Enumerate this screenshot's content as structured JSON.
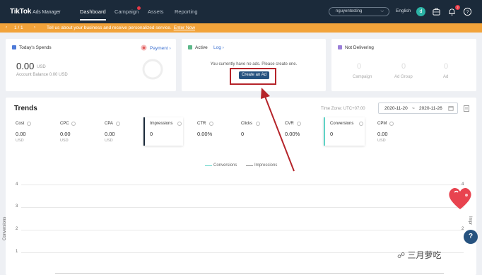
{
  "nav": {
    "logo": "TikTok",
    "logo_sub": "Ads Manager",
    "items": [
      "Dashboard",
      "Campaign",
      "Assets",
      "Reporting"
    ],
    "account": "nguyentesting",
    "language": "English",
    "avatar_letter": "d",
    "notification_count": "2"
  },
  "banner": {
    "page_indicator": "1 / 1",
    "message": "Tell us about your business and receive personalized service.",
    "link": "Enter Now"
  },
  "spends_card": {
    "title": "Today's Spends",
    "payment_label": "Payment",
    "amount": "0.00",
    "currency": "USD",
    "balance": "Account Balance 0.00 USD"
  },
  "active_card": {
    "status": "Active",
    "log_label": "Log",
    "message": "You currently have no ads. Please create one.",
    "create_button": "Create an Ad"
  },
  "not_delivering_card": {
    "title": "Not Delivering",
    "stats": [
      {
        "value": "0",
        "label": "Campaign"
      },
      {
        "value": "0",
        "label": "Ad Group"
      },
      {
        "value": "0",
        "label": "Ad"
      }
    ]
  },
  "trends": {
    "title": "Trends",
    "timezone": "Time Zone: UTC+07:00",
    "date_start": "2020-11-20",
    "date_sep": "~",
    "date_end": "2020-11-26",
    "metrics": [
      {
        "label": "Cost",
        "value": "0.00",
        "unit": "USD"
      },
      {
        "label": "CPC",
        "value": "0.00",
        "unit": "USD"
      },
      {
        "label": "CPA",
        "value": "0.00",
        "unit": "USD"
      },
      {
        "label": "Impressions",
        "value": "0",
        "unit": ""
      },
      {
        "label": "CTR",
        "value": "0.00%",
        "unit": ""
      },
      {
        "label": "Clicks",
        "value": "0",
        "unit": ""
      },
      {
        "label": "CVR",
        "value": "0.00%",
        "unit": ""
      },
      {
        "label": "Conversions",
        "value": "0",
        "unit": ""
      },
      {
        "label": "CPM",
        "value": "0.00",
        "unit": "USD"
      }
    ],
    "legend": [
      "Conversions",
      "Impressions"
    ],
    "y_left_label": "Conversions",
    "y_right_label": "Impr",
    "y_ticks_left": [
      "4",
      "3",
      "2",
      "1"
    ],
    "y_ticks_right": [
      "4",
      "2"
    ]
  },
  "chart_data": {
    "type": "line",
    "series": [
      {
        "name": "Conversions",
        "values": []
      },
      {
        "name": "Impressions",
        "values": []
      }
    ],
    "ylabel": "Conversions",
    "ylim": [
      0,
      4
    ],
    "legend_position": "top-center",
    "grid": true
  },
  "colors": {
    "nav_bg": "#1b2a3a",
    "banner": "#f2a33a",
    "primary_button": "#26527f",
    "annotation_red": "#b5242a",
    "conversions_line": "#5fd3c6",
    "impressions_line": "#888888"
  },
  "watermark": "三月萝吃"
}
